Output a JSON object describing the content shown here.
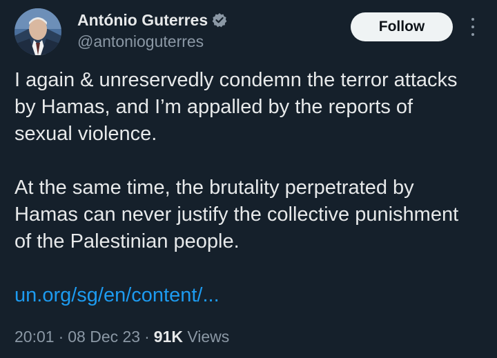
{
  "author": {
    "display_name": "António Guterres",
    "handle": "@antonioguterres",
    "verified_icon": "verified-badge-icon",
    "verified_color": "#8b98a5"
  },
  "actions": {
    "follow_label": "Follow",
    "more_icon": "more-options-icon"
  },
  "tweet": {
    "paragraph_1": "I again & unreservedly condemn the terror attacks by Hamas, and I’m appalled by the reports of sexual violence.",
    "paragraph_2": "At the same time, the brutality perpetrated by Hamas can never justify the collective punishment of the Palestinian people.",
    "link_text": "un.org/sg/en/content/..."
  },
  "meta": {
    "time": "20:01",
    "separator": "·",
    "date": "08 Dec 23",
    "views_count": "91K",
    "views_label": "Views"
  },
  "colors": {
    "background": "#15202b",
    "text_primary": "#e7e9ea",
    "text_secondary": "#8b98a5",
    "link": "#1d9bf0",
    "follow_bg": "#eff3f4"
  }
}
